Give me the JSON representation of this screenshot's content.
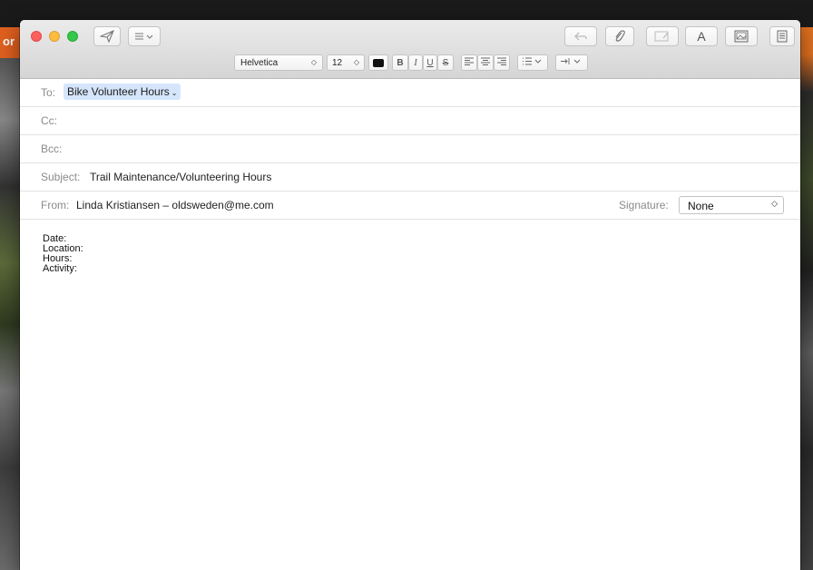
{
  "background": {
    "text": "or"
  },
  "window": {
    "toolbar": {
      "send_icon": "paper-plane-icon",
      "header_fields_icon": "list-chevron-icon",
      "reply_icon": "reply-arrow-icon",
      "attach_icon": "paperclip-icon",
      "markup_icon": "markup-icon",
      "fonts_label": "A",
      "photo_icon": "photo-browser-icon",
      "format_icon": "format-panel-icon"
    },
    "format_bar": {
      "font_name": "Helvetica",
      "font_size": "12",
      "text_color": "#111111",
      "bold": "B",
      "italic": "I",
      "underline": "U",
      "strikethrough": "S"
    },
    "fields": {
      "to_label": "To:",
      "to_recipient": "Bike Volunteer Hours",
      "cc_label": "Cc:",
      "bcc_label": "Bcc:",
      "subject_label": "Subject:",
      "subject_value": "Trail Maintenance/Volunteering Hours",
      "from_label": "From:",
      "from_value": "Linda Kristiansen – oldsweden@me.com",
      "signature_label": "Signature:",
      "signature_value": "None"
    },
    "body_lines": [
      "Date:",
      "Location:",
      "Hours:",
      "Activity:"
    ]
  },
  "colors": {
    "close": "#fc605c",
    "minimize": "#fdbc40",
    "zoom": "#34c84a",
    "token_bg": "#d5e5fb"
  }
}
